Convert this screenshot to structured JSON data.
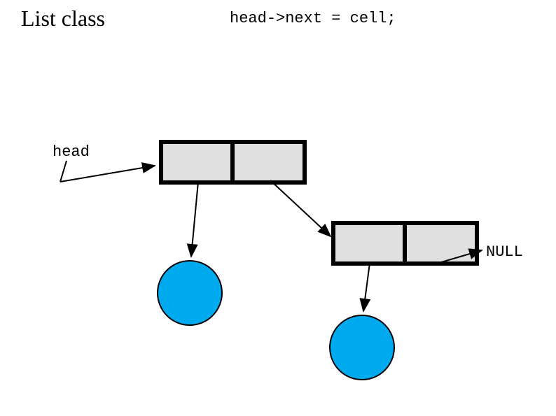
{
  "title": "List class",
  "code": "head->next = cell;",
  "labels": {
    "head": "head",
    "null": "NULL"
  }
}
